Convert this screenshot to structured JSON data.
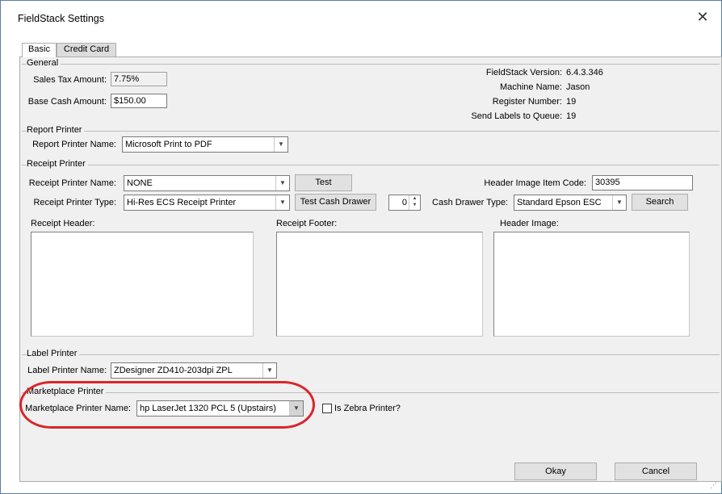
{
  "window": {
    "title": "FieldStack Settings"
  },
  "tabs": [
    {
      "label": "Basic",
      "active": true
    },
    {
      "label": "Credit Card",
      "active": false
    }
  ],
  "general": {
    "legend": "General",
    "sales_tax_label": "Sales Tax Amount:",
    "sales_tax_value": "7.75%",
    "base_cash_label": "Base Cash Amount:",
    "base_cash_value": "$150.00",
    "info": [
      {
        "label": "FieldStack Version:",
        "value": "6.4.3.346"
      },
      {
        "label": "Machine Name:",
        "value": "Jason"
      },
      {
        "label": "Register Number:",
        "value": "19"
      },
      {
        "label": "Send Labels to Queue:",
        "value": "19"
      }
    ]
  },
  "report_printer": {
    "legend": "Report Printer",
    "name_label": "Report Printer Name:",
    "name_value": "Microsoft Print to PDF"
  },
  "receipt_printer": {
    "legend": "Receipt Printer",
    "name_label": "Receipt Printer Name:",
    "name_value": "NONE",
    "test_button": "Test",
    "type_label": "Receipt Printer Type:",
    "type_value": "Hi-Res ECS Receipt Printer",
    "test_drawer_button": "Test Cash Drawer",
    "spinner_value": "0",
    "header_item_label": "Header Image Item Code:",
    "header_item_value": "30395",
    "drawer_type_label": "Cash Drawer Type:",
    "drawer_type_value": "Standard Epson ESC",
    "search_button": "Search",
    "receipt_header_label": "Receipt Header:",
    "receipt_footer_label": "Receipt Footer:",
    "header_image_label": "Header Image:"
  },
  "label_printer": {
    "legend": "Label Printer",
    "name_label": "Label Printer Name:",
    "name_value": "ZDesigner ZD410-203dpi ZPL"
  },
  "marketplace_printer": {
    "legend": "Marketplace Printer",
    "name_label": "Marketplace Printer Name:",
    "name_value": "hp LaserJet 1320 PCL 5 (Upstairs)",
    "zebra_label": "Is Zebra Printer?",
    "zebra_checked": false
  },
  "footer": {
    "okay": "Okay",
    "cancel": "Cancel"
  },
  "icons": {
    "close": "close-icon",
    "dropdown": "chevron-down-icon",
    "grip": "resize-grip-icon"
  },
  "colors": {
    "annotation": "#d9262b",
    "panel": "#f0f0f0",
    "border": "#adadad"
  }
}
